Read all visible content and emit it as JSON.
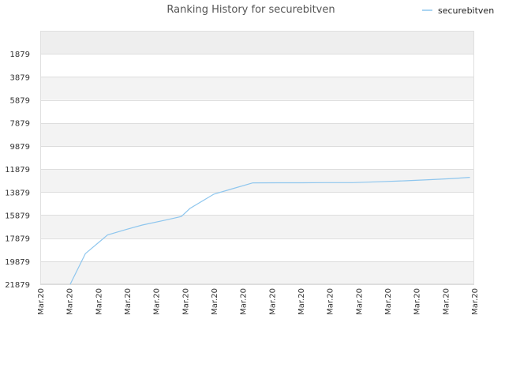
{
  "chart_data": {
    "type": "line",
    "title": "Ranking History for securebitven",
    "xlabel": "",
    "ylabel": "",
    "y_inverted": true,
    "ylim": [
      21879,
      -122
    ],
    "y_ticks": [
      1879,
      3879,
      5879,
      7879,
      9879,
      11879,
      13879,
      15879,
      17879,
      19879,
      21879
    ],
    "x_tick_labels": [
      "Mar.20",
      "Mar.20",
      "Mar.20",
      "Mar.20",
      "Mar.20",
      "Mar.20",
      "Mar.20",
      "Mar.20",
      "Mar.20",
      "Mar.20",
      "Mar.20",
      "Mar.20",
      "Mar.20",
      "Mar.20",
      "Mar.20",
      "Mar.20"
    ],
    "grid": true,
    "legend_position": "top-right",
    "series": [
      {
        "name": "securebitven",
        "color": "#8ec6ee",
        "points": [
          [
            0.069,
            21879
          ],
          [
            0.104,
            19220
          ],
          [
            0.155,
            17600
          ],
          [
            0.2,
            17100
          ],
          [
            0.235,
            16740
          ],
          [
            0.29,
            16300
          ],
          [
            0.325,
            16000
          ],
          [
            0.345,
            15300
          ],
          [
            0.4,
            14060
          ],
          [
            0.44,
            13620
          ],
          [
            0.49,
            13080
          ],
          [
            0.545,
            13070
          ],
          [
            0.6,
            13070
          ],
          [
            0.655,
            13060
          ],
          [
            0.72,
            13060
          ],
          [
            0.78,
            12980
          ],
          [
            0.84,
            12900
          ],
          [
            0.9,
            12800
          ],
          [
            0.95,
            12700
          ],
          [
            0.99,
            12600
          ]
        ]
      }
    ]
  }
}
